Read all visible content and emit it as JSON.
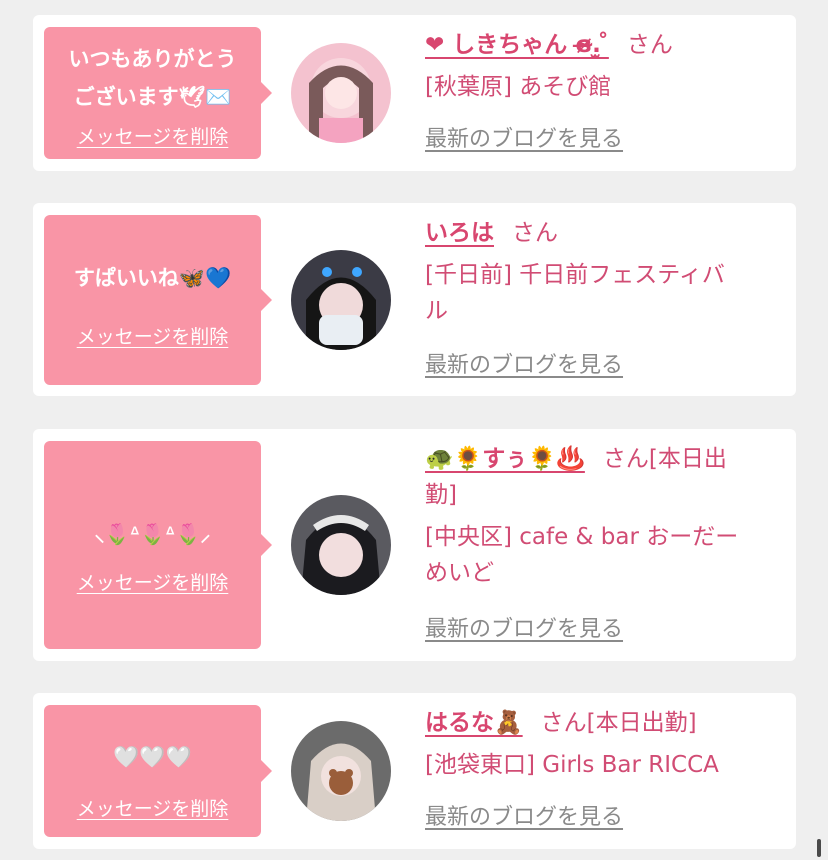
{
  "cards": [
    {
      "message_line1": "いつもありがとう",
      "message_line2": "ございます🕊✉️",
      "delete_label": "メッセージを削除",
      "name": "❤ しきちゃん ɞ̴̶̷.̫ ̊",
      "honorific": "さん",
      "status": "",
      "shop_line1": "[秋葉原] あそび館",
      "shop_line2": "",
      "blog_label": "最新のブログを見る"
    },
    {
      "message_line1": "すぱいいね🦋💙",
      "delete_label": "メッセージを削除",
      "name": "いろは",
      "honorific": "さん",
      "status": "",
      "shop_line1": "[千日前] 千日前フェスティバ",
      "shop_line2": "ル",
      "blog_label": "最新のブログを見る"
    },
    {
      "message_line1": "⸜🌷ᐞ🌷ᐞ🌷⸝",
      "delete_label": "メッセージを削除",
      "name": "🐢🌻すぅ🌻♨️",
      "honorific": "さん",
      "status": "[本日出",
      "status2": "勤]",
      "shop_line1": "[中央区] cafe & bar おーだー",
      "shop_line2": "めいど",
      "blog_label": "最新のブログを見る"
    },
    {
      "message_line1": "🤍🤍🤍",
      "delete_label": "メッセージを削除",
      "name": "はるな🧸",
      "honorific": "さん",
      "status": "[本日出勤]",
      "shop_line1": "[池袋東口] Girls Bar RICCA",
      "shop_line2": "",
      "blog_label": "最新のブログを見る"
    }
  ],
  "colors": {
    "background": "#efefef",
    "card": "#ffffff",
    "bubble": "#f995a6",
    "accent_text": "#d14c74",
    "link_gray": "#8a8a8a"
  }
}
